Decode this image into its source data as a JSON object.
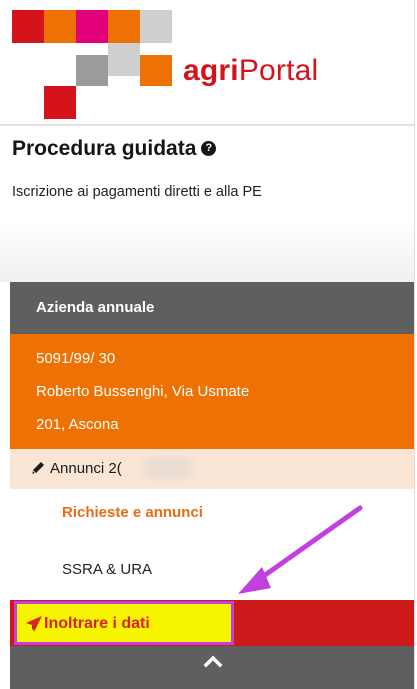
{
  "app": {
    "brand_bold": "agri",
    "brand_rest": "Portal",
    "logo_colors": {
      "red": "#d4131b",
      "orange": "#ee7203",
      "magenta": "#e2007a",
      "grey": "#9b9b9b",
      "lightgrey": "#cfcfcf"
    }
  },
  "page": {
    "title": "Procedura guidata",
    "help_icon": "question-circle-icon",
    "subtitle": "Iscrizione ai pagamenti diretti e alla PE"
  },
  "sidebar": {
    "header": "Azienda annuale",
    "farm": {
      "id": "5091/99/ 30",
      "address_line1": "Roberto Bussenghi, Via Usmate",
      "address_line2": "201, Ascona"
    },
    "section": {
      "icon": "pencil-icon",
      "label": "Annunci 2("
    },
    "items": [
      {
        "label": "Richieste e annunci",
        "active": true
      },
      {
        "label": "SSRA & URA",
        "active": false
      }
    ],
    "submit": {
      "icon": "paper-plane-icon",
      "label": "Inoltrare i dati"
    },
    "collapse_icon": "chevron-up-icon"
  },
  "annotation": {
    "arrow_color": "#c23fe0",
    "highlight_fill": "#f7f400"
  }
}
